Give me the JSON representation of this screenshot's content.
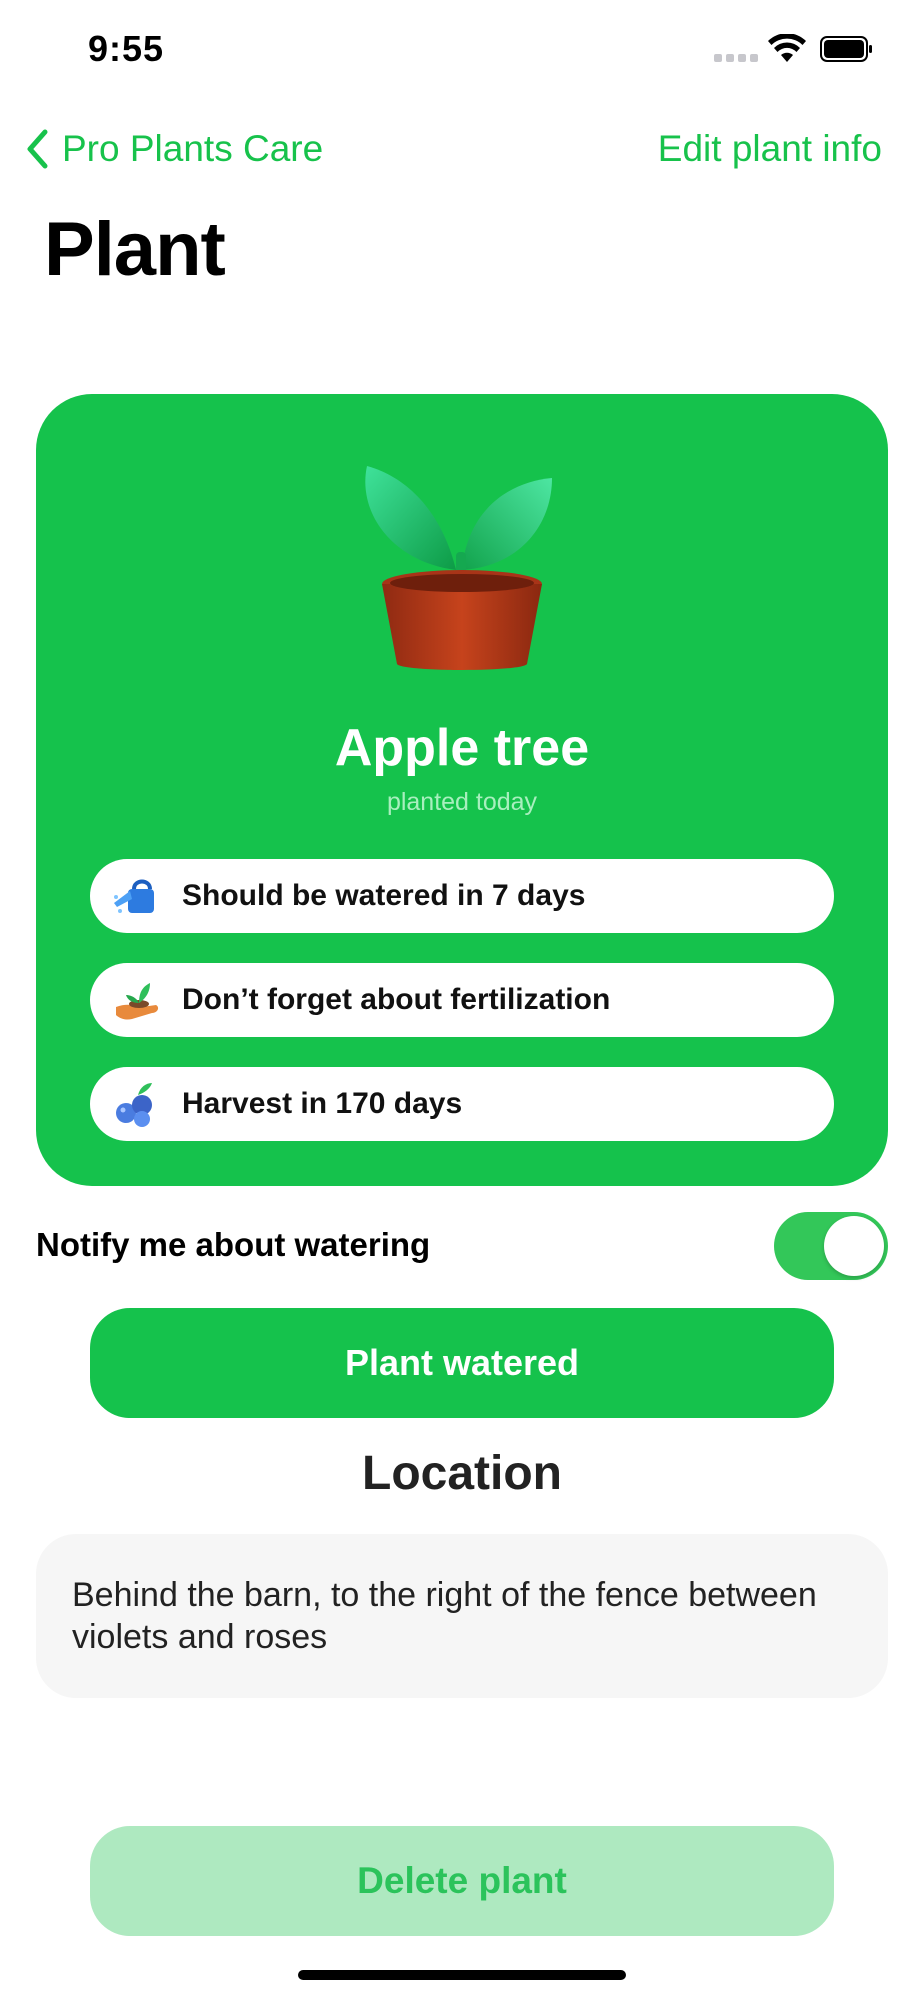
{
  "status_bar": {
    "time": "9:55"
  },
  "nav": {
    "back_label": "Pro Plants Care",
    "edit_label": "Edit plant info"
  },
  "page_title": "Plant",
  "plant_card": {
    "name": "Apple tree",
    "planted": "planted today",
    "image_icon": "potted-plant-icon",
    "info": [
      {
        "icon": "watering-can-icon",
        "text": "Should be watered in 7 days"
      },
      {
        "icon": "fertilizer-icon",
        "text": "Don’t forget about fertilization"
      },
      {
        "icon": "harvest-icon",
        "text": "Harvest in 170 days"
      }
    ]
  },
  "notify": {
    "label": "Notify me about watering",
    "enabled": true
  },
  "water_button_label": "Plant watered",
  "location": {
    "heading": "Location",
    "text": "Behind the barn, to the right of the fence between violets and roses"
  },
  "delete_button_label": "Delete plant",
  "colors": {
    "accent": "#15c24c",
    "toggle_on": "#33c759",
    "delete_bg": "#aee9c0"
  }
}
